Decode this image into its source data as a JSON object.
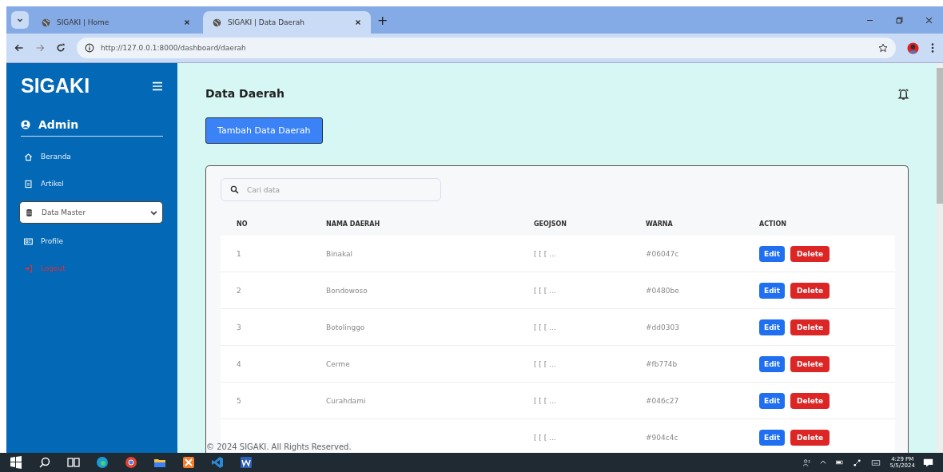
{
  "browser": {
    "tabs": [
      {
        "title": "SIGAKI | Home",
        "selected": false
      },
      {
        "title": "SIGAKI | Data Daerah",
        "selected": true
      }
    ],
    "new_tab": "+",
    "url": "http://127.0.0.1:8000/dashboard/daerah"
  },
  "sidebar": {
    "brand": "SIGAKI",
    "user": "Admin",
    "items": [
      {
        "label": "Beranda",
        "selected": false,
        "kind": "link"
      },
      {
        "label": "Artikel",
        "selected": false,
        "kind": "link"
      },
      {
        "label": "Data Master",
        "selected": true,
        "kind": "dropdown"
      },
      {
        "label": "Profile",
        "selected": false,
        "kind": "link"
      },
      {
        "label": "Logout",
        "selected": false,
        "kind": "danger"
      }
    ]
  },
  "page": {
    "title": "Data Daerah",
    "add_button": "Tambah Data Daerah",
    "search": {
      "placeholder": "Cari data"
    },
    "table": {
      "columns": [
        "NO",
        "NAMA DAERAH",
        "GEOJSON",
        "WARNA",
        "ACTION"
      ],
      "rows": [
        {
          "no": "1",
          "name": "Binakal",
          "geojson": "[ [ [ ...",
          "warna": "#06047c",
          "edit": "Edit",
          "delete": "Delete"
        },
        {
          "no": "2",
          "name": "Bondowoso",
          "geojson": "[ [ [ ...",
          "warna": "#0480be",
          "edit": "Edit",
          "delete": "Delete"
        },
        {
          "no": "3",
          "name": "Botolinggo",
          "geojson": "[ [ [ ...",
          "warna": "#dd0303",
          "edit": "Edit",
          "delete": "Delete"
        },
        {
          "no": "4",
          "name": "Cerme",
          "geojson": "[ [ [ ...",
          "warna": "#fb774b",
          "edit": "Edit",
          "delete": "Delete"
        },
        {
          "no": "5",
          "name": "Curahdami",
          "geojson": "[ [ [ ...",
          "warna": "#046c27",
          "edit": "Edit",
          "delete": "Delete"
        },
        {
          "geojson": "[ [ [ ...",
          "warna": "#904c4c",
          "edit": "Edit",
          "delete": "Delete"
        }
      ]
    },
    "footer": "© 2024 SIGAKI. All Rights Reserved."
  },
  "taskbar": {
    "time": "4:29 PM",
    "date": "5/5/2024"
  }
}
